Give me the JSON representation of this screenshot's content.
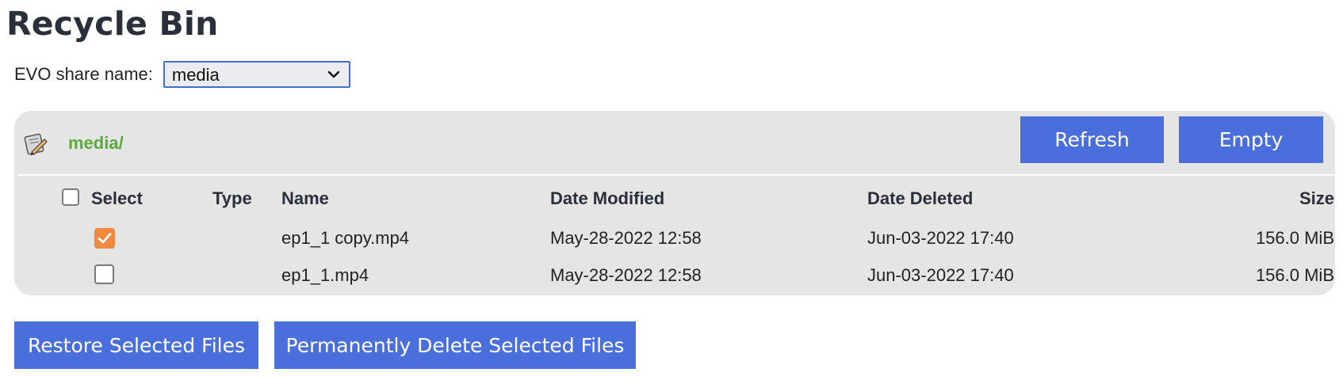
{
  "page": {
    "title": "Recycle Bin"
  },
  "share": {
    "label": "EVO share name:",
    "selected": "media"
  },
  "panel": {
    "path": "media/",
    "refresh_label": "Refresh",
    "empty_label": "Empty"
  },
  "table": {
    "columns": {
      "select": "Select",
      "type": "Type",
      "name": "Name",
      "modified": "Date Modified",
      "deleted": "Date Deleted",
      "size": "Size"
    },
    "select_all_checked": false,
    "rows": [
      {
        "checked": true,
        "type": "",
        "name": "ep1_1 copy.mp4",
        "modified": "May-28-2022 12:58",
        "deleted": "Jun-03-2022 17:40",
        "size": "156.0 MiB"
      },
      {
        "checked": false,
        "type": "",
        "name": "ep1_1.mp4",
        "modified": "May-28-2022 12:58",
        "deleted": "Jun-03-2022 17:40",
        "size": "156.0 MiB"
      }
    ]
  },
  "actions": {
    "restore_label": "Restore Selected Files",
    "delete_label": "Permanently Delete Selected Files"
  },
  "colors": {
    "accent": "#4a6fdc",
    "path": "#5aaa3c",
    "checkbox_checked": "#f0883e",
    "panel_bg": "#e5e5e5"
  },
  "icons": {
    "folder": "folder-pencil-icon",
    "dropdown": "chevron-down-icon",
    "check": "checkmark-icon"
  }
}
